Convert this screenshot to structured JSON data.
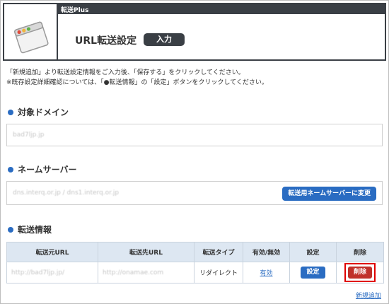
{
  "header": {
    "bar_title": "転送Plus",
    "title": "URL転送設定",
    "status": "入力"
  },
  "instructions": {
    "line1": "「新規追加」より転送設定情報をご入力後、「保存する」をクリックしてください。",
    "line2": "※既存設定詳細確認については、「●転送情報」の「設定」ボタンをクリックしてください。"
  },
  "target_domain": {
    "title": "対象ドメイン",
    "value": "bad7ljp.jp"
  },
  "nameserver": {
    "title": "ネームサーバー",
    "value": "dns.interq.or.jp / dns1.interq.or.jp",
    "button": "転送用ネームサーバーに変更"
  },
  "transfer_info": {
    "title": "転送情報",
    "columns": [
      "転送元URL",
      "転送先URL",
      "転送タイプ",
      "有効/無効",
      "設定",
      "削除"
    ],
    "rows": [
      {
        "source": "http://bad7ljp.jp/",
        "destination": "http://onamae.com",
        "type": "リダイレクト",
        "status": "有効",
        "settings_button": "設定",
        "delete_button": "削除"
      }
    ],
    "add_new": "新規追加"
  },
  "colors": {
    "header_dark": "#3a3f45",
    "accent_blue": "#2a6cc2",
    "delete_red": "#c0302a",
    "highlight_red": "#e00000",
    "table_header_bg": "#dde7f2"
  }
}
